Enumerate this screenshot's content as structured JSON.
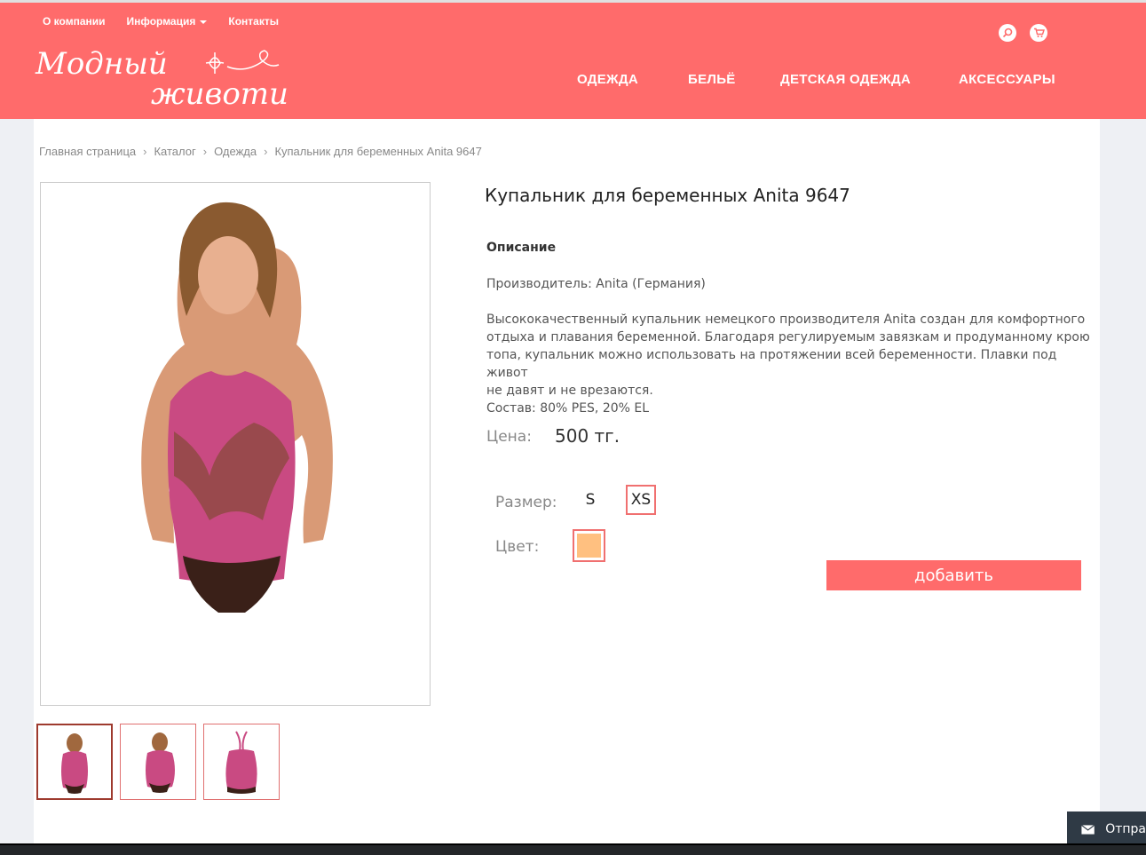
{
  "header": {
    "top_links": {
      "about": "О компании",
      "info": "Информация",
      "contacts": "Контакты"
    },
    "logo_text": [
      "Модный",
      "животик"
    ],
    "nav": {
      "clothes": "ОДЕЖДА",
      "lingerie": "БЕЛЬЁ",
      "kids": "ДЕТСКАЯ ОДЕЖДА",
      "accessories": "АКСЕССУАРЫ"
    },
    "accent_color": "#ff6b6b"
  },
  "breadcrumb": [
    "Главная страница",
    "Каталог",
    "Одежда",
    "Купальник для беременных Anita 9647"
  ],
  "product": {
    "title": "Купальник для беременных Anita 9647",
    "description_heading": "Описание",
    "manufacturer": "Производитель: Anita (Германия)",
    "description": [
      "Высококачественный купальник немецкого производителя Anita создан для комфортного",
      "отдыха и плавания беременной. Благодаря регулируемым завязкам и продуманному крою",
      "топа, купальник можно использовать на протяжении всей беременности. Плавки под живот",
      "не давят и не врезаются."
    ],
    "composition": "Состав: 80% PES, 20% EL",
    "price_label": "Цена:",
    "price": "500 тг.",
    "size_label": "Размер:",
    "sizes": [
      "S",
      "XS"
    ],
    "color_label": "Цвет:",
    "color_swatch": "#ffc080",
    "add_button": "добавить"
  },
  "chat_widget": {
    "label": "Отпра"
  }
}
